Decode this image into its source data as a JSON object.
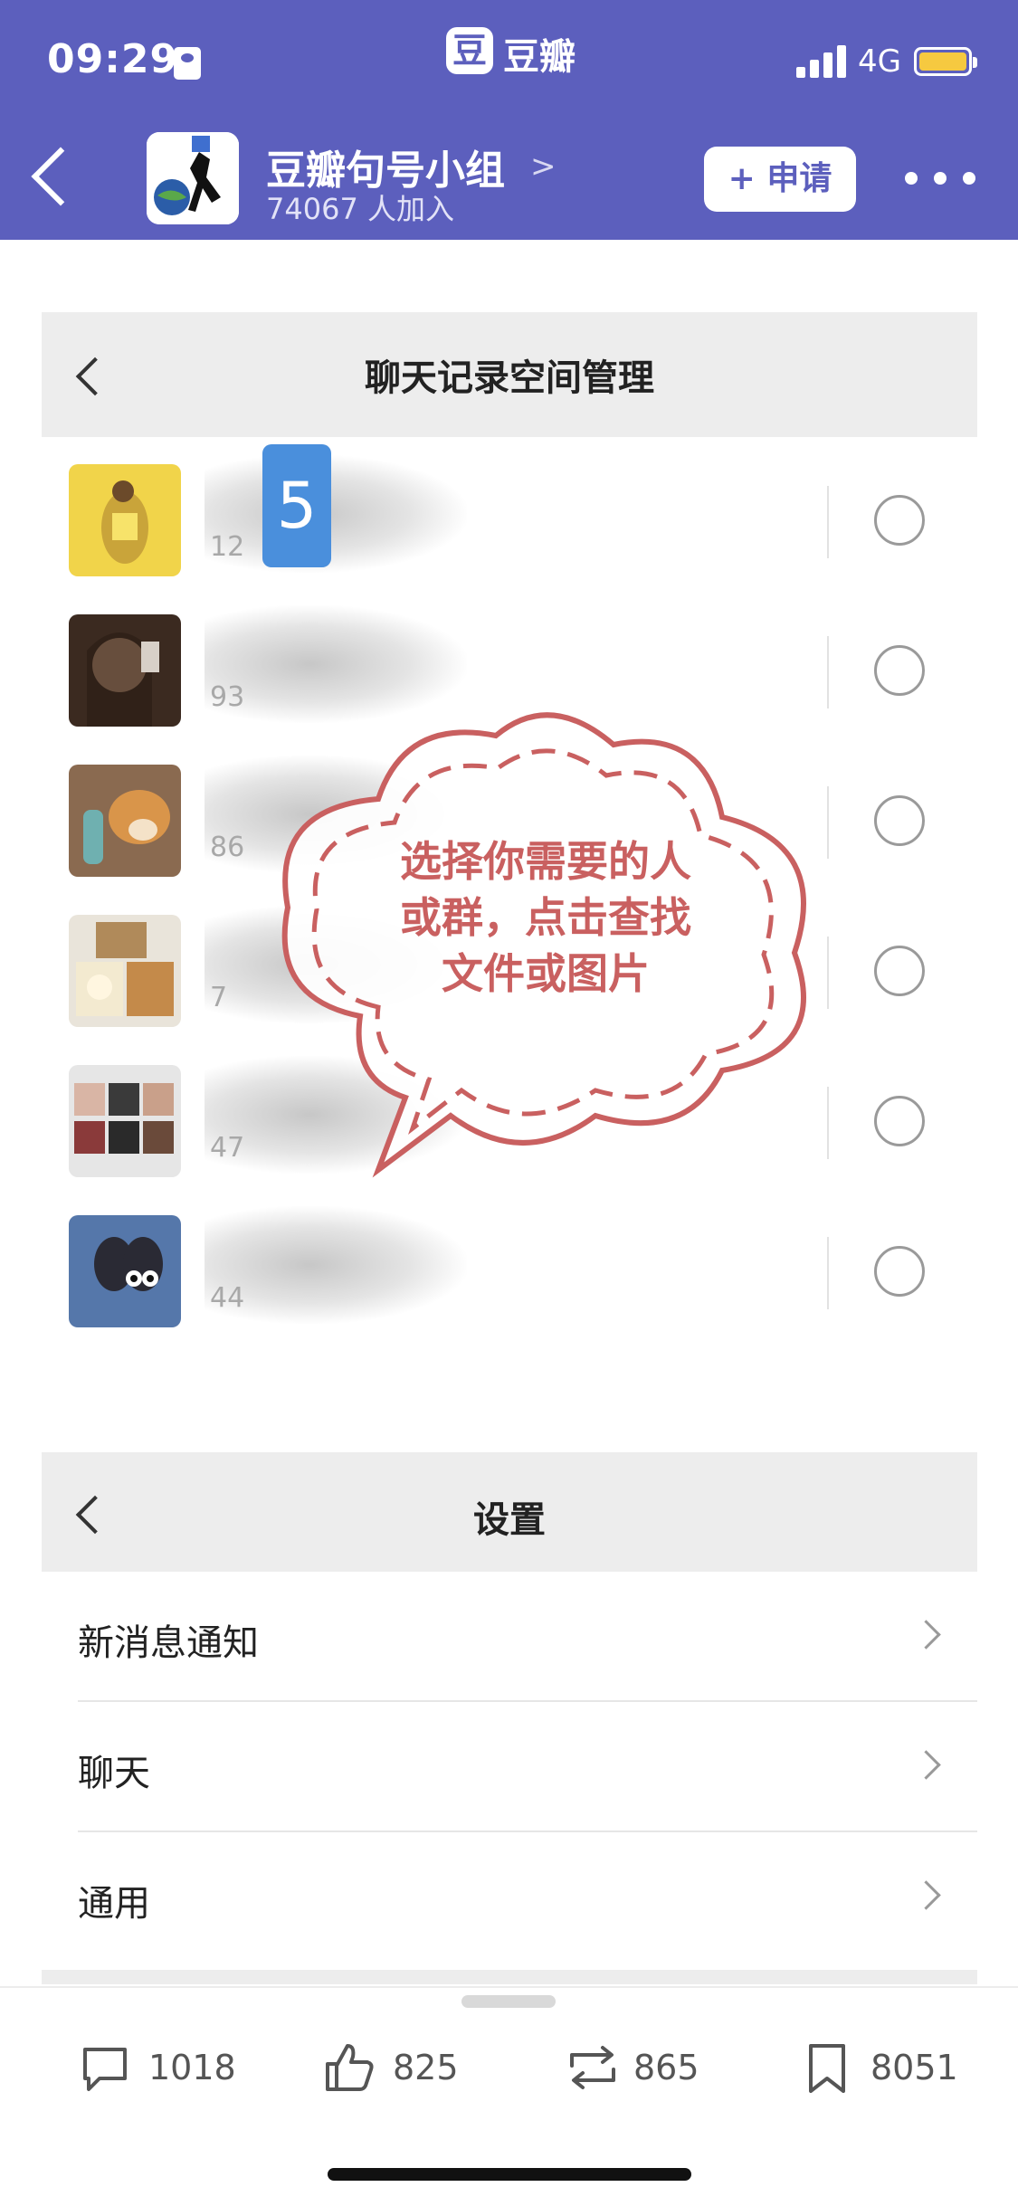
{
  "status_bar": {
    "time": "09:29",
    "app_name": "豆瓣",
    "app_logo_char": "豆",
    "network": "4G",
    "battery_color": "#f6c940"
  },
  "header": {
    "back_icon": "chevron-left-icon",
    "group_name": "豆瓣句号小组",
    "group_name_arrow": ">",
    "member_count": "74067 人加入",
    "apply_button": "+ 申请",
    "more_icon": "ellipsis-icon",
    "background_color": "#5c5fbd"
  },
  "chat_manage_card": {
    "title": "聊天记录空间管理",
    "step_number": "5",
    "tip_text": "选择你需要的人或群，点击查找文件或图片",
    "tip_color": "#c96060",
    "rows": [
      {
        "count": "12"
      },
      {
        "count": "93"
      },
      {
        "count": "86"
      },
      {
        "count": "7"
      },
      {
        "count": "47"
      },
      {
        "count": "44"
      }
    ]
  },
  "settings_card": {
    "title": "设置",
    "items": [
      {
        "label": "新消息通知"
      },
      {
        "label": "聊天"
      },
      {
        "label": "通用"
      }
    ]
  },
  "action_bar": {
    "comments": "1018",
    "likes": "825",
    "reshares": "865",
    "collects": "8051"
  }
}
